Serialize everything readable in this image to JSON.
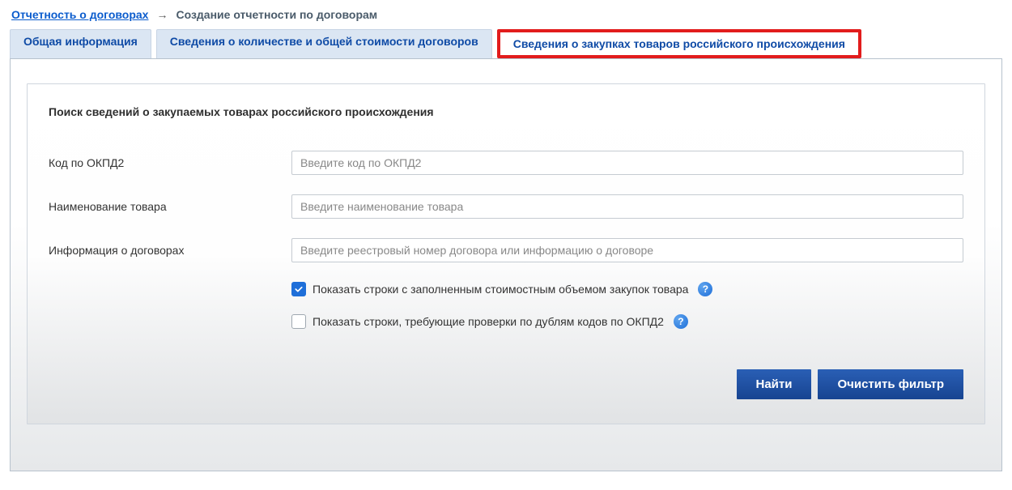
{
  "breadcrumb": {
    "root": "Отчетность о договорах",
    "current": "Создание отчетности по договорам"
  },
  "tabs": [
    {
      "label": "Общая информация"
    },
    {
      "label": "Сведения о количестве и общей стоимости договоров"
    },
    {
      "label": "Сведения о закупках товаров российского происхождения"
    }
  ],
  "section": {
    "title": "Поиск сведений о закупаемых товарах российского происхождения"
  },
  "form": {
    "okpd2": {
      "label": "Код по ОКПД2",
      "placeholder": "Введите код по ОКПД2",
      "value": ""
    },
    "product_name": {
      "label": "Наименование товара",
      "placeholder": "Введите наименование товара",
      "value": ""
    },
    "contract_info": {
      "label": "Информация о договорах",
      "placeholder": "Введите реестровый номер договора или информацию о договоре",
      "value": ""
    },
    "cb_filled": {
      "label": "Показать строки с заполненным стоимостным объемом закупок товара",
      "checked": true
    },
    "cb_duplicates": {
      "label": "Показать строки, требующие проверки по дублям кодов по ОКПД2",
      "checked": false
    }
  },
  "buttons": {
    "search": "Найти",
    "clear": "Очистить фильтр"
  }
}
